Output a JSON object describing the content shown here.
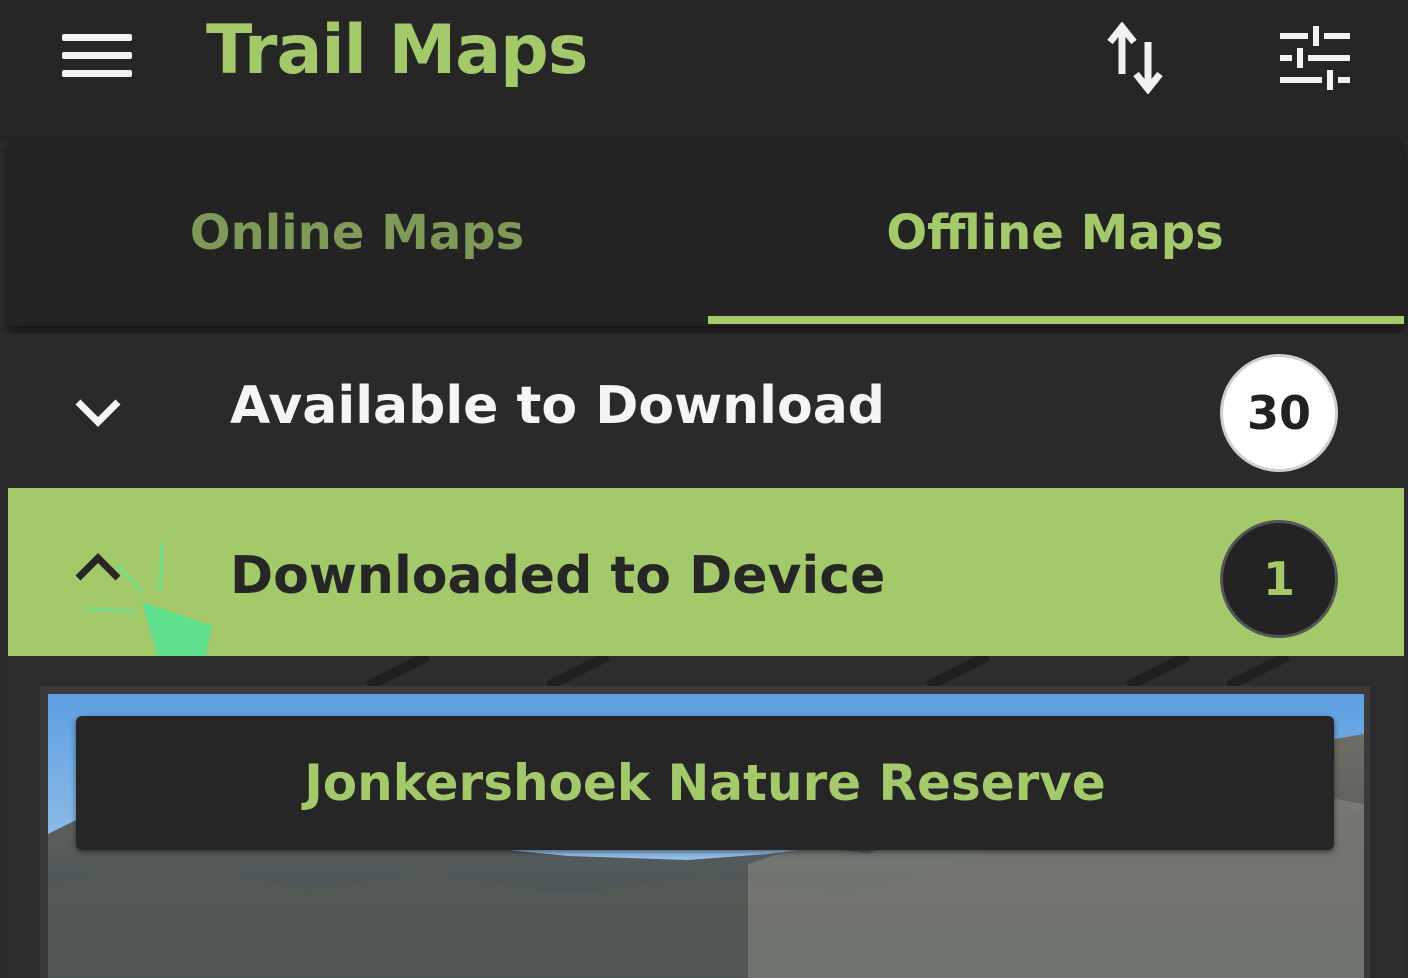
{
  "header": {
    "title": "Trail Maps",
    "menu_icon": "hamburger-menu-icon",
    "sort_icon": "sort-arrows-icon",
    "filter_icon": "sliders-filter-icon"
  },
  "tabs": [
    {
      "label": "Online Maps",
      "active": false
    },
    {
      "label": "Offline Maps",
      "active": true
    }
  ],
  "sections": {
    "available": {
      "label": "Available to Download",
      "count": "30",
      "expanded": false,
      "icon": "chevron-down-icon"
    },
    "downloaded": {
      "label": "Downloaded to Device",
      "count": "1",
      "expanded": true,
      "icon": "chevron-up-icon"
    }
  },
  "maps": [
    {
      "title": "Jonkershoek Nature Reserve"
    }
  ],
  "colors": {
    "accent": "#a4c96b",
    "header_bg": "#272626",
    "tab_bg": "#242323",
    "text_light": "#f5f5f5",
    "text_dark": "#262626"
  }
}
